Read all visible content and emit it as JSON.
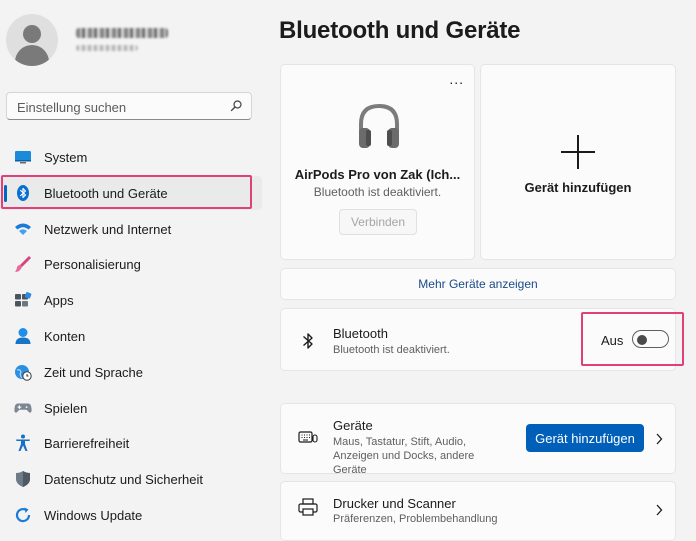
{
  "user": {
    "name_obscured": true
  },
  "search": {
    "placeholder": "Einstellung suchen"
  },
  "sidebar": {
    "items": [
      {
        "label": "System",
        "icon": "system-icon"
      },
      {
        "label": "Bluetooth und Geräte",
        "icon": "bluetooth-icon",
        "selected": true
      },
      {
        "label": "Netzwerk und Internet",
        "icon": "wifi-icon"
      },
      {
        "label": "Personalisierung",
        "icon": "brush-icon"
      },
      {
        "label": "Apps",
        "icon": "apps-icon"
      },
      {
        "label": "Konten",
        "icon": "account-icon"
      },
      {
        "label": "Zeit und Sprache",
        "icon": "globe-clock-icon"
      },
      {
        "label": "Spielen",
        "icon": "gamepad-icon"
      },
      {
        "label": "Barrierefreiheit",
        "icon": "accessibility-icon"
      },
      {
        "label": "Datenschutz und Sicherheit",
        "icon": "shield-icon"
      },
      {
        "label": "Windows Update",
        "icon": "update-icon"
      }
    ]
  },
  "main": {
    "title": "Bluetooth und Geräte",
    "device_card": {
      "name": "AirPods Pro von Zak (Ich...",
      "status": "Bluetooth ist deaktiviert.",
      "connect_label": "Verbinden",
      "more_label": "..."
    },
    "add_card": {
      "label": "Gerät hinzufügen"
    },
    "more_devices": "Mehr Geräte anzeigen",
    "bluetooth": {
      "title": "Bluetooth",
      "subtitle": "Bluetooth ist deaktiviert.",
      "state": "Aus",
      "on": false
    },
    "devices": {
      "title": "Geräte",
      "subtitle": "Maus, Tastatur, Stift, Audio, Anzeigen und Docks, andere Geräte",
      "button": "Gerät hinzufügen"
    },
    "printers": {
      "title": "Drucker und Scanner",
      "subtitle": "Präferenzen, Problembehandlung"
    }
  },
  "colors": {
    "accent": "#005fb8",
    "highlight": "#e0407a",
    "background": "#f3f3f3"
  }
}
